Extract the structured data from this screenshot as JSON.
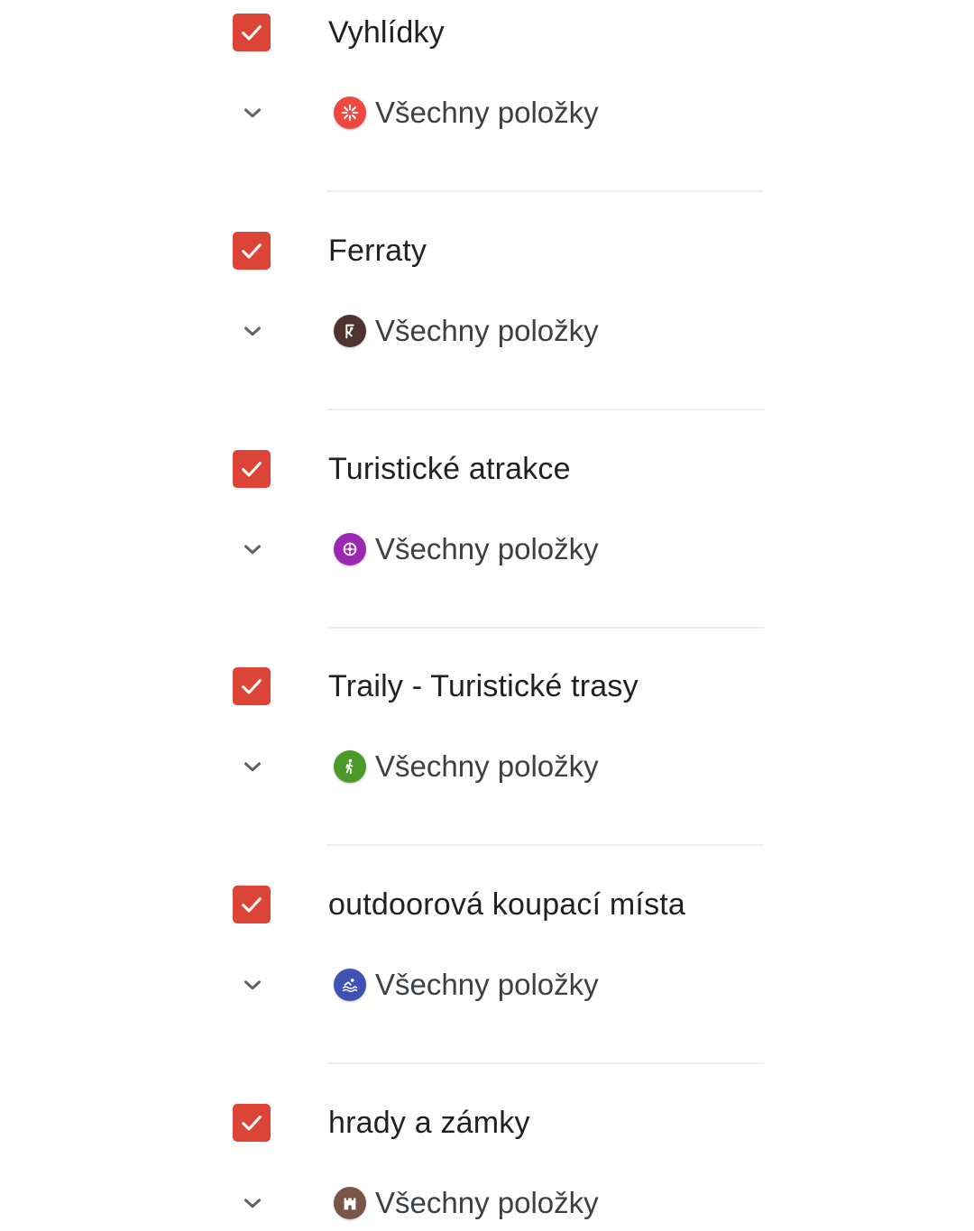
{
  "colors": {
    "checkbox": "#db4437",
    "chevron": "#5f6368",
    "divider": "#eeeeee"
  },
  "layers": [
    {
      "title": "Vyhlídky",
      "checked": true,
      "style_label": "Všechny položky",
      "icon": "viewpoint-icon",
      "icon_color": "#f0483e"
    },
    {
      "title": "Ferraty",
      "checked": true,
      "style_label": "Všechny položky",
      "icon": "climbing-icon",
      "icon_color": "#4e342e"
    },
    {
      "title": "Turistické atrakce",
      "checked": true,
      "style_label": "Všechny položky",
      "icon": "attraction-icon",
      "icon_color": "#9c27b0"
    },
    {
      "title": "Traily - Turistické trasy",
      "checked": true,
      "style_label": "Všechny položky",
      "icon": "hiking-icon",
      "icon_color": "#4c9a2a"
    },
    {
      "title": "outdoorová koupací místa",
      "checked": true,
      "style_label": "Všechny položky",
      "icon": "swimming-icon",
      "icon_color": "#3f51b5"
    },
    {
      "title": "hrady a zámky",
      "checked": true,
      "style_label": "Všechny položky",
      "icon": "castle-icon",
      "icon_color": "#795548"
    }
  ]
}
